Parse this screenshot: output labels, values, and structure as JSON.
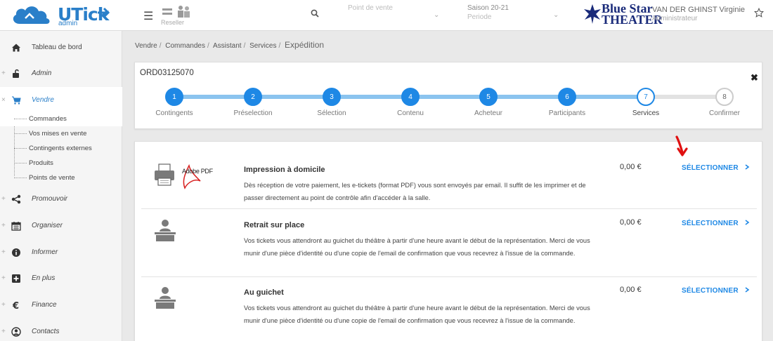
{
  "app": {
    "logo_text": "UTick",
    "logo_sub": "admin",
    "reseller_label": "Reseller",
    "point_de_vente_placeholder": "Point de vente",
    "saison_value": "Saison 20-21",
    "saison_sub": "Periode",
    "theater_name_line1": "Blue Star",
    "theater_name_line2": "THEATER",
    "user_name": "VAN DER GHINST Virginie",
    "user_role": "Administrateur"
  },
  "sidebar": {
    "items": [
      {
        "label": "Tableau de bord",
        "icon": "home-icon"
      },
      {
        "label": "Admin",
        "icon": "lock-icon"
      },
      {
        "label": "Vendre",
        "icon": "cart-icon"
      },
      {
        "label": "Promouvoir",
        "icon": "share-icon"
      },
      {
        "label": "Organiser",
        "icon": "calendar-icon"
      },
      {
        "label": "Informer",
        "icon": "info-icon"
      },
      {
        "label": "En plus",
        "icon": "plus-square-icon"
      },
      {
        "label": "Finance",
        "icon": "euro-icon"
      },
      {
        "label": "Contacts",
        "icon": "user-icon"
      }
    ],
    "vendre_sub": [
      {
        "label": "Commandes"
      },
      {
        "label": "Vos mises en vente"
      },
      {
        "label": "Contingents externes"
      },
      {
        "label": "Produits"
      },
      {
        "label": "Points de vente"
      }
    ]
  },
  "breadcrumb": {
    "items": [
      "Vendre",
      "Commandes",
      "Assistant",
      "Services"
    ],
    "current": "Expédition"
  },
  "wizard": {
    "order_id": "ORD03125070",
    "progress_fraction": 0.857,
    "steps": [
      {
        "num": "1",
        "label": "Contingents",
        "state": "done"
      },
      {
        "num": "2",
        "label": "Préselection",
        "state": "done"
      },
      {
        "num": "3",
        "label": "Sélection",
        "state": "done"
      },
      {
        "num": "4",
        "label": "Contenu",
        "state": "done"
      },
      {
        "num": "5",
        "label": "Acheteur",
        "state": "done"
      },
      {
        "num": "6",
        "label": "Participants",
        "state": "done"
      },
      {
        "num": "7",
        "label": "Services",
        "state": "current"
      },
      {
        "num": "8",
        "label": "Confirmer",
        "state": "todo"
      }
    ]
  },
  "services": [
    {
      "title": "Impression à domicile",
      "desc": "Dès réception de votre paiement, les e-tickets (format PDF) vous sont envoyés par email. Il suffit de les imprimer et de passer directement au point de contrôle afin d'accéder à la salle.",
      "price": "0,00 €",
      "select_label": "SÉLECTIONNER",
      "icon": "printer-pdf-icon",
      "adobe_label": "Adobe PDF"
    },
    {
      "title": "Retrait sur place",
      "desc": "Vos tickets vous attendront au guichet du théâtre à partir d'une heure avant le début de la représentation. Merci de vous munir d'une pièce d'identité ou d'une copie de l'email de confirmation que vous recevrez à l'issue de la commande.",
      "price": "0,00 €",
      "select_label": "SÉLECTIONNER",
      "icon": "counter-desk-icon"
    },
    {
      "title": "Au guichet",
      "desc": "Vos tickets vous attendront au guichet du théâtre à partir d'une heure avant le début de la représentation. Merci de vous munir d'une pièce d'identité ou d'une copie de l'email de confirmation que vous recevrez à l'issue de la commande.",
      "price": "0,00 €",
      "select_label": "SÉLECTIONNER",
      "icon": "counter-desk-icon"
    }
  ],
  "colors": {
    "accent": "#1e88e5",
    "track_fill": "#8bc4ef",
    "annotation_red": "#e01010"
  }
}
